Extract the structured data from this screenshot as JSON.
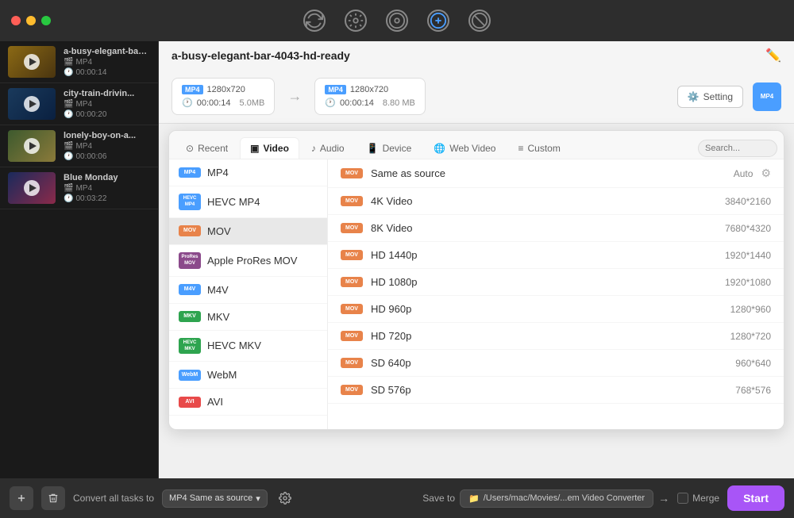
{
  "titleBar": {
    "dots": [
      "red",
      "yellow",
      "green"
    ],
    "icons": [
      {
        "name": "convert-icon",
        "label": "↻",
        "active": false
      },
      {
        "name": "edit-icon",
        "label": "⚙",
        "active": false
      },
      {
        "name": "disc-icon",
        "label": "◎",
        "active": false
      },
      {
        "name": "settings-icon",
        "label": "⊕",
        "active": false
      },
      {
        "name": "tools-icon",
        "label": "⊗",
        "active": false
      }
    ]
  },
  "sidebar": {
    "items": [
      {
        "name": "a-busy-elegant-bar-4043-hd-ready",
        "shortName": "a-busy-elegant-bar-4043-hd-ready",
        "format": "MP4",
        "duration": "00:00:14",
        "thumbClass": "thumb-1"
      },
      {
        "name": "city-train-drivin...",
        "shortName": "city-train-drivin...",
        "format": "MP4",
        "duration": "00:00:20",
        "thumbClass": "thumb-2"
      },
      {
        "name": "lonely-boy-on-a...",
        "shortName": "lonely-boy-on-a...",
        "format": "MP4",
        "duration": "00:00:06",
        "thumbClass": "thumb-3"
      },
      {
        "name": "Blue Monday",
        "shortName": "Blue Monday",
        "format": "MP4",
        "duration": "00:03:22",
        "thumbClass": "thumb-4"
      }
    ]
  },
  "fileInfo": {
    "title": "a-busy-elegant-bar-4043-hd-ready",
    "source": {
      "format": "MP4",
      "resolution": "1280x720",
      "duration": "00:00:14",
      "size": "5.0MB"
    },
    "dest": {
      "format": "MP4",
      "resolution": "1280x720",
      "duration": "00:00:14",
      "size": "8.80 MB"
    },
    "settingBtn": "Setting"
  },
  "dropdown": {
    "tabs": [
      {
        "id": "recent",
        "label": "Recent",
        "icon": "⊙"
      },
      {
        "id": "video",
        "label": "Video",
        "icon": "▣",
        "active": true
      },
      {
        "id": "audio",
        "label": "Audio",
        "icon": "♪"
      },
      {
        "id": "device",
        "label": "Device",
        "icon": "📱"
      },
      {
        "id": "webvideo",
        "label": "Web Video",
        "icon": "🌐"
      },
      {
        "id": "custom",
        "label": "Custom",
        "icon": "≡"
      }
    ],
    "searchPlaceholder": "Search...",
    "formats": [
      {
        "label": "MP4",
        "badge": "MP4",
        "badgeClass": "fmt-mp4"
      },
      {
        "label": "HEVC MP4",
        "badge": "HEVC MP4",
        "badgeClass": "fmt-hevc"
      },
      {
        "label": "MOV",
        "badge": "MOV",
        "badgeClass": "fmt-mov",
        "selected": true
      },
      {
        "label": "Apple ProRes MOV",
        "badge": "ProRes MOV",
        "badgeClass": "fmt-pror"
      },
      {
        "label": "M4V",
        "badge": "M4V",
        "badgeClass": "fmt-m4v"
      },
      {
        "label": "MKV",
        "badge": "MKV",
        "badgeClass": "fmt-mkv"
      },
      {
        "label": "HEVC MKV",
        "badge": "HEVC MKV",
        "badgeClass": "fmt-hevc-mkv"
      },
      {
        "label": "WebM",
        "badge": "WebM",
        "badgeClass": "fmt-webm"
      },
      {
        "label": "AVI",
        "badge": "AVI",
        "badgeClass": "fmt-avi"
      }
    ],
    "resolutions": [
      {
        "label": "Same as source",
        "value": "Auto",
        "hasGear": true
      },
      {
        "label": "4K Video",
        "value": "3840*2160"
      },
      {
        "label": "8K Video",
        "value": "7680*4320"
      },
      {
        "label": "HD 1440p",
        "value": "1920*1440"
      },
      {
        "label": "HD 1080p",
        "value": "1920*1080"
      },
      {
        "label": "HD 960p",
        "value": "1280*960"
      },
      {
        "label": "HD 720p",
        "value": "1280*720"
      },
      {
        "label": "SD 640p",
        "value": "960*640"
      },
      {
        "label": "SD 576p",
        "value": "768*576"
      }
    ]
  },
  "bottomBar": {
    "convertLabel": "Convert all tasks to",
    "convertValue": "MP4 Same as source",
    "saveLabel": "Save to",
    "savePath": "/Users/mac/Movies/...em Video Converter",
    "mergeLabel": "Merge",
    "startLabel": "Start"
  }
}
